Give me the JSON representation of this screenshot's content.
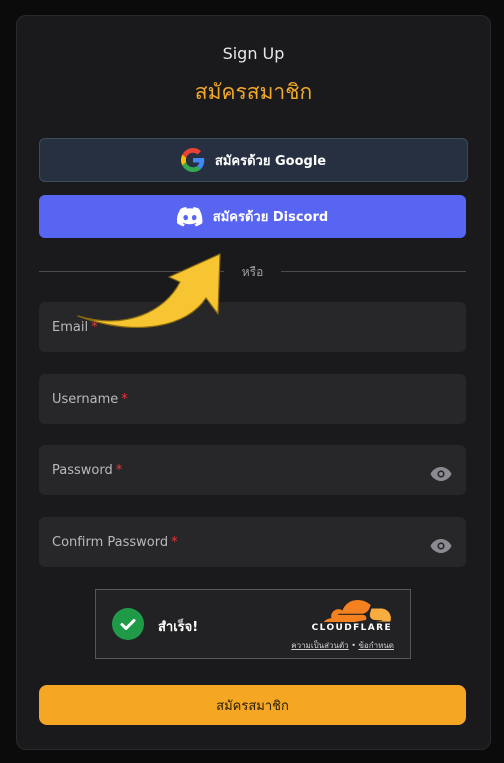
{
  "header": {
    "title": "Sign Up",
    "subtitle": "สมัครสมาชิก"
  },
  "oauth": {
    "google_label": "สมัครด้วย Google",
    "discord_label": "สมัครด้วย Discord"
  },
  "divider": {
    "text": "หรือ"
  },
  "form": {
    "email_label": "Email",
    "username_label": "Username",
    "password_label": "Password",
    "confirm_password_label": "Confirm Password",
    "required_mark": "*"
  },
  "captcha": {
    "status": "สำเร็จ!",
    "provider": "CLOUDFLARE",
    "privacy_link": "ความเป็นส่วนตัว",
    "separator": "•",
    "terms_link": "ข้อกำหนด"
  },
  "submit": {
    "label": "สมัครสมาชิก"
  },
  "colors": {
    "accent": "#f5a623",
    "discord": "#5865f2",
    "google_button": "#263041",
    "required": "#e03a3a",
    "success": "#1f9b48",
    "annotation_arrow": "#f7c531"
  },
  "icons": {
    "google": "google-icon",
    "discord": "discord-icon",
    "eye": "eye-icon",
    "check": "check-circle-icon",
    "cloudflare": "cloudflare-logo-icon",
    "annotation": "curved-arrow-icon"
  }
}
